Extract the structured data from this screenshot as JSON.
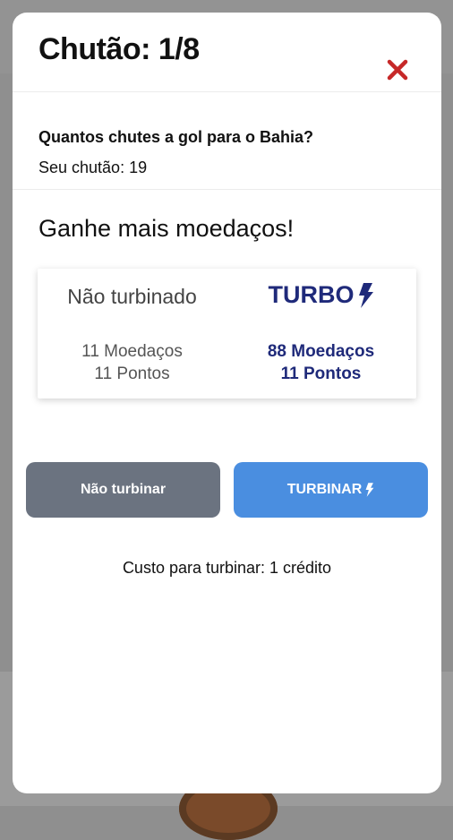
{
  "modal": {
    "title": "Chutão: 1/8",
    "question": "Quantos chutes a gol para o Bahia?",
    "guess_label": "Seu chutão:",
    "guess_value": "19",
    "promo": "Ganhe mais moedaços!",
    "comparison": {
      "left": {
        "title": "Não turbinado",
        "coins": "11 Moedaços",
        "points": "11 Pontos"
      },
      "right": {
        "title": "TURBO",
        "coins": "88 Moedaços",
        "points": "11 Pontos"
      }
    },
    "buttons": {
      "no_turbo": "Não turbinar",
      "turbo": "TURBINAR"
    },
    "cost": "Custo para turbinar: 1 crédito"
  },
  "colors": {
    "turbo_text": "#1f2a7a",
    "close_icon": "#c62828",
    "button_gray": "#6b7380",
    "button_blue": "#4a8ee0"
  },
  "icons": {
    "close": "close-icon",
    "bolt": "lightning-bolt-icon"
  }
}
